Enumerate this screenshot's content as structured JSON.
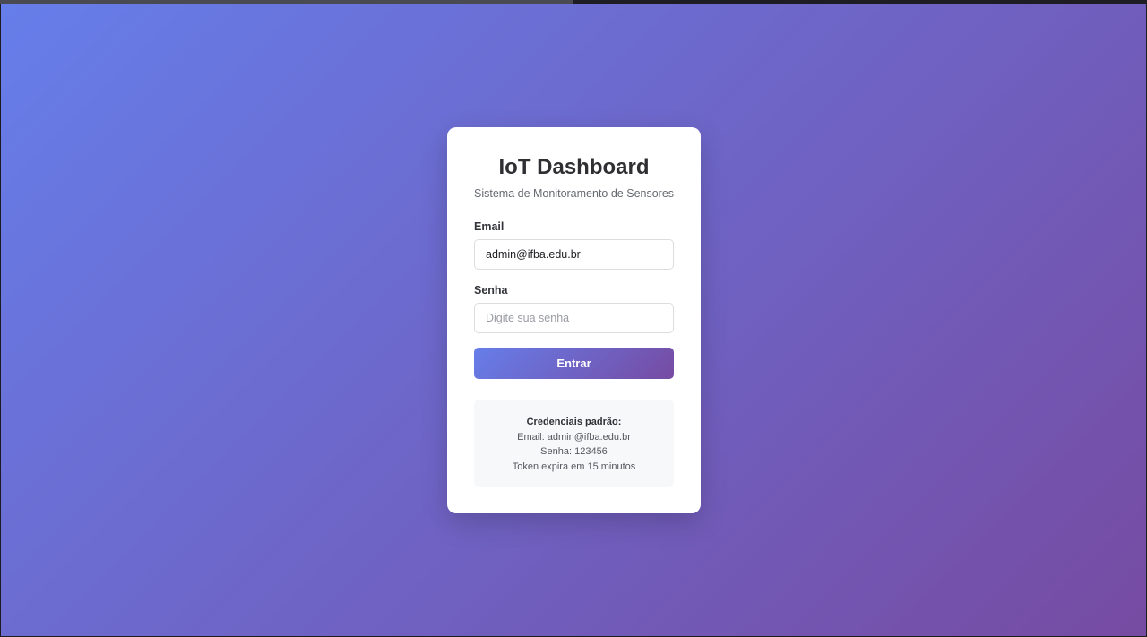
{
  "browser": {
    "loading_progress_percent": 50
  },
  "colors": {
    "gradient_start": "#667eea",
    "gradient_end": "#764ba2",
    "card_background": "#ffffff",
    "info_background": "#f7f8fa"
  },
  "login": {
    "title": "IoT Dashboard",
    "subtitle": "Sistema de Monitoramento de Sensores",
    "email_label": "Email",
    "email_value": "admin@ifba.edu.br",
    "password_label": "Senha",
    "password_placeholder": "Digite sua senha",
    "submit_label": "Entrar"
  },
  "credentials_info": {
    "title": "Credenciais padrão:",
    "email_line": "Email: admin@ifba.edu.br",
    "password_line": "Senha: 123456",
    "token_line": "Token expira em 15 minutos"
  }
}
